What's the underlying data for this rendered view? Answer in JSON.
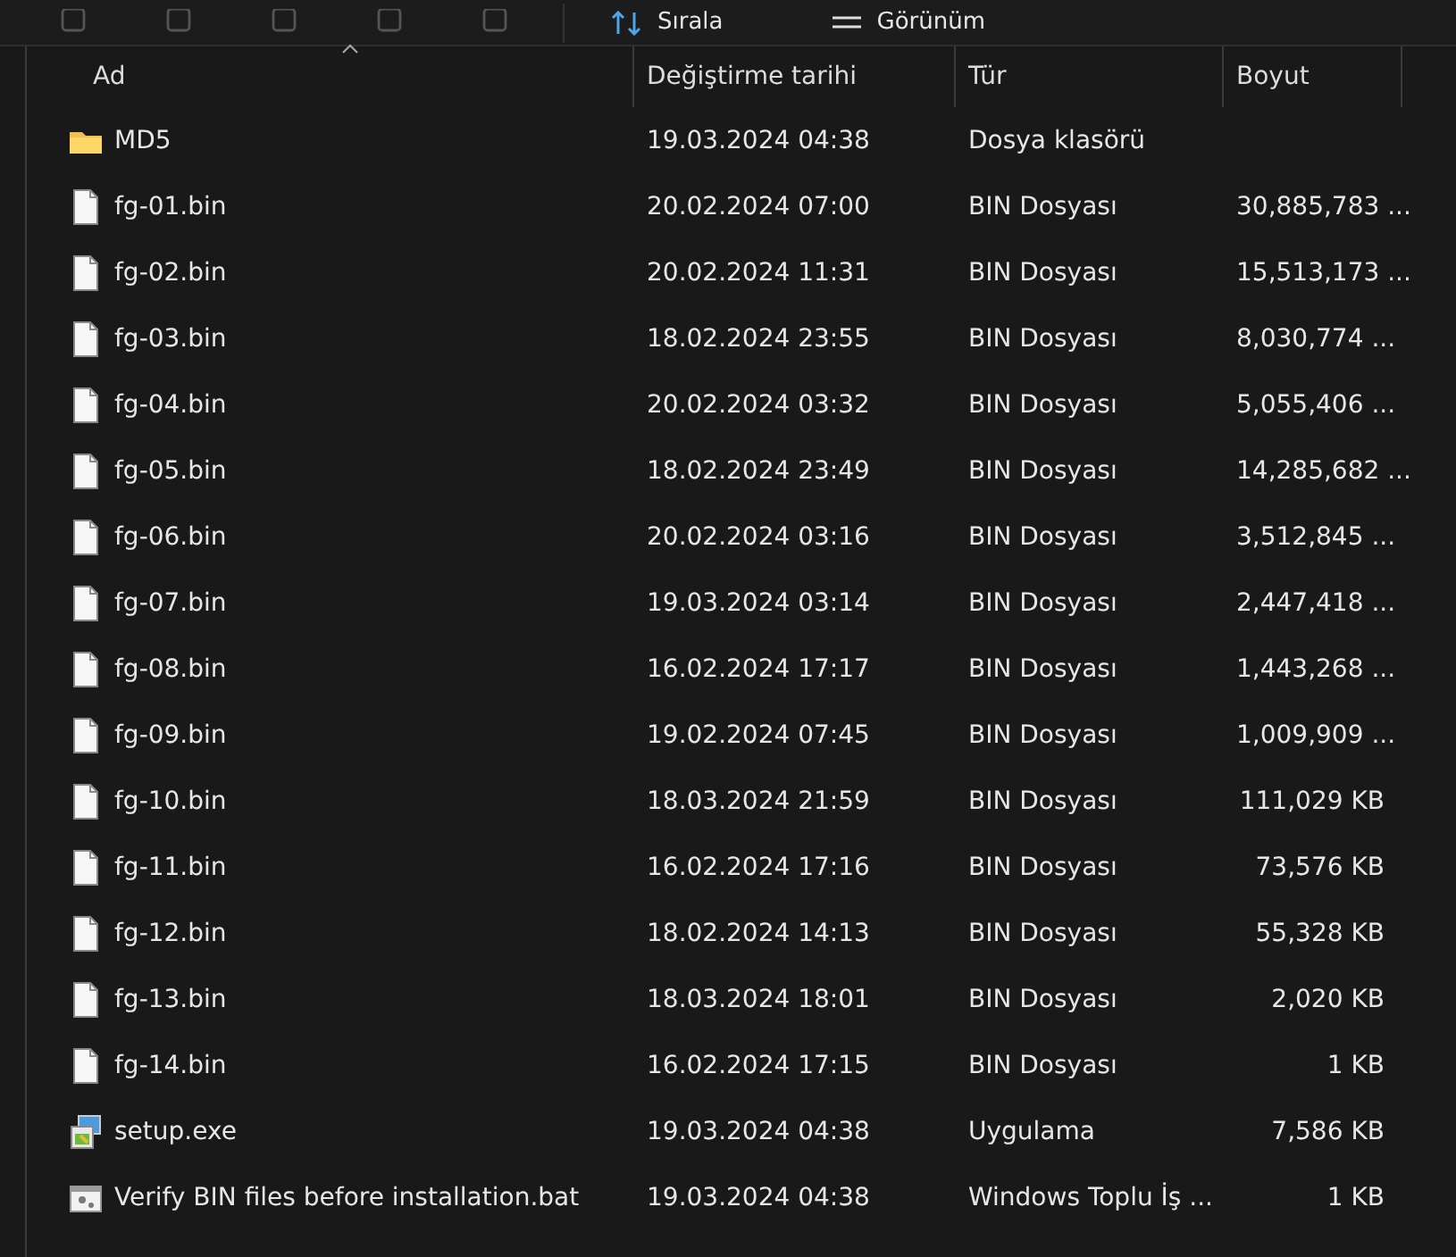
{
  "toolbar": {
    "buttons": [
      {
        "kind": "sort",
        "label": "Sırala"
      },
      {
        "kind": "view",
        "label": "Görünüm"
      }
    ]
  },
  "table": {
    "columns": [
      {
        "label": "Ad",
        "sorted": true
      },
      {
        "label": "Değiştirme tarihi",
        "sorted": false
      },
      {
        "label": "Tür",
        "sorted": false
      },
      {
        "label": "Boyut",
        "sorted": false
      }
    ],
    "rows": [
      {
        "kind": "folder",
        "name": "MD5",
        "date": "19.03.2024 04:38",
        "type": "Dosya klasörü",
        "size": ""
      },
      {
        "kind": "file",
        "name": "fg-01.bin",
        "date": "20.02.2024 07:00",
        "type": "BIN Dosyası",
        "size": "30,885,783 ..."
      },
      {
        "kind": "file",
        "name": "fg-02.bin",
        "date": "20.02.2024 11:31",
        "type": "BIN Dosyası",
        "size": "15,513,173 ..."
      },
      {
        "kind": "file",
        "name": "fg-03.bin",
        "date": "18.02.2024 23:55",
        "type": "BIN Dosyası",
        "size": "8,030,774 ..."
      },
      {
        "kind": "file",
        "name": "fg-04.bin",
        "date": "20.02.2024 03:32",
        "type": "BIN Dosyası",
        "size": "5,055,406 ..."
      },
      {
        "kind": "file",
        "name": "fg-05.bin",
        "date": "18.02.2024 23:49",
        "type": "BIN Dosyası",
        "size": "14,285,682 ..."
      },
      {
        "kind": "file",
        "name": "fg-06.bin",
        "date": "20.02.2024 03:16",
        "type": "BIN Dosyası",
        "size": "3,512,845 ..."
      },
      {
        "kind": "file",
        "name": "fg-07.bin",
        "date": "19.03.2024 03:14",
        "type": "BIN Dosyası",
        "size": "2,447,418 ..."
      },
      {
        "kind": "file",
        "name": "fg-08.bin",
        "date": "16.02.2024 17:17",
        "type": "BIN Dosyası",
        "size": "1,443,268 ..."
      },
      {
        "kind": "file",
        "name": "fg-09.bin",
        "date": "19.02.2024 07:45",
        "type": "BIN Dosyası",
        "size": "1,009,909 ..."
      },
      {
        "kind": "file",
        "name": "fg-10.bin",
        "date": "18.03.2024 21:59",
        "type": "BIN Dosyası",
        "size": "111,029 KB"
      },
      {
        "kind": "file",
        "name": "fg-11.bin",
        "date": "16.02.2024 17:16",
        "type": "BIN Dosyası",
        "size": "73,576 KB"
      },
      {
        "kind": "file",
        "name": "fg-12.bin",
        "date": "18.02.2024 14:13",
        "type": "BIN Dosyası",
        "size": "55,328 KB"
      },
      {
        "kind": "file",
        "name": "fg-13.bin",
        "date": "18.03.2024 18:01",
        "type": "BIN Dosyası",
        "size": "2,020 KB"
      },
      {
        "kind": "file",
        "name": "fg-14.bin",
        "date": "16.02.2024 17:15",
        "type": "BIN Dosyası",
        "size": "1 KB"
      },
      {
        "kind": "exe",
        "name": "setup.exe",
        "date": "19.03.2024 04:38",
        "type": "Uygulama",
        "size": "7,586 KB"
      },
      {
        "kind": "bat",
        "name": "Verify BIN files before installation.bat",
        "date": "19.03.2024 04:38",
        "type": "Windows Toplu İş ...",
        "size": "1 KB"
      }
    ]
  }
}
